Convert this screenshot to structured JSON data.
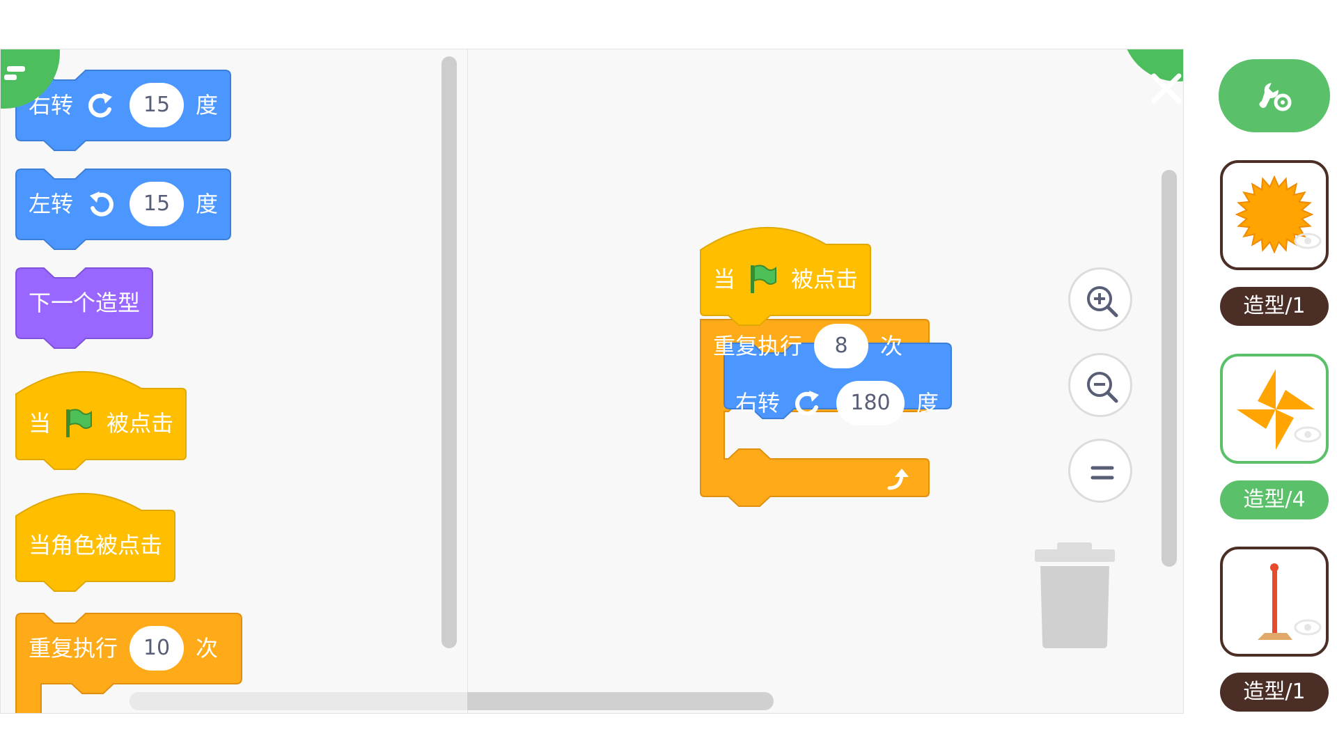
{
  "palette": {
    "blocks": [
      {
        "id": "turn-right",
        "label": "右转",
        "value": "15",
        "unit": "度",
        "color": "#4c97ff"
      },
      {
        "id": "turn-left",
        "label": "左转",
        "value": "15",
        "unit": "度",
        "color": "#4c97ff"
      },
      {
        "id": "next-costume",
        "label": "下一个造型",
        "color": "#9966ff"
      },
      {
        "id": "when-flag",
        "before": "当",
        "after": "被点击",
        "color": "#ffbf00"
      },
      {
        "id": "when-sprite",
        "label": "当角色被点击",
        "color": "#ffbf00"
      },
      {
        "id": "repeat",
        "label": "重复执行",
        "value": "10",
        "unit": "次",
        "color": "#ffab19"
      }
    ]
  },
  "script": {
    "hat": {
      "before": "当",
      "after": "被点击"
    },
    "repeat": {
      "label": "重复执行",
      "value": "8",
      "unit": "次"
    },
    "turn": {
      "label": "右转",
      "value": "180",
      "unit": "度"
    }
  },
  "sprites": [
    {
      "name": "造型/1",
      "selected": false,
      "icon": "sun-sprite-icon"
    },
    {
      "name": "造型/4",
      "selected": true,
      "icon": "pinwheel-sprite-icon"
    },
    {
      "name": "造型/1",
      "selected": false,
      "icon": "flagpole-sprite-icon"
    }
  ],
  "colors": {
    "accent": "#4dbe5e",
    "motion": "#4c97ff",
    "looks": "#9966ff",
    "events": "#ffbf00",
    "control": "#ffab19",
    "sprite_dark": "#4b2e25"
  }
}
